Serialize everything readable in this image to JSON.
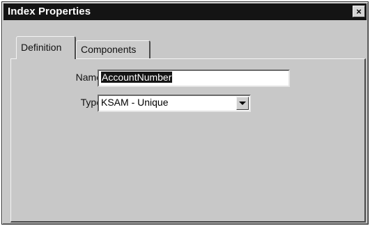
{
  "window": {
    "title": "Index Properties",
    "close_glyph": "×"
  },
  "tabs": [
    {
      "label": "Definition",
      "active": true
    },
    {
      "label": "Components",
      "active": false
    }
  ],
  "definition": {
    "name_label": "Name",
    "name_value": "AccountNumber",
    "name_text_selected": true,
    "type_label": "Type",
    "type_value": "KSAM - Unique"
  },
  "icons": {
    "close": "close-icon",
    "dropdown": "chevron-down-icon"
  },
  "colors": {
    "titlebar_bg": "#141414",
    "dialog_bg": "#c8c8c8",
    "selection_bg": "#141414"
  }
}
